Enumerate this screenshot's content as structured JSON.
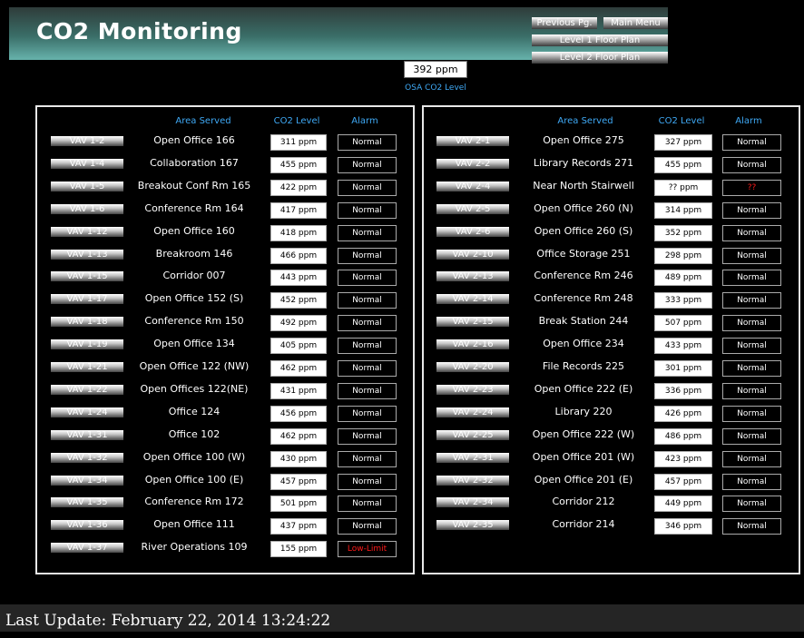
{
  "header": {
    "title": "CO2 Monitoring",
    "previous_label": "Previous Pg.",
    "main_menu_label": "Main Menu",
    "level1_label": "Level 1 Floor Plan",
    "level2_label": "Level 2 Floor Plan"
  },
  "osa": {
    "value": "392 ppm",
    "label": "OSA CO2 Level"
  },
  "columns": {
    "area": "Area Served",
    "co2": "CO2 Level",
    "alarm": "Alarm"
  },
  "left": [
    {
      "vav": "VAV 1-2",
      "area": "Open Office 166",
      "co2": "311 ppm",
      "alarm": "Normal"
    },
    {
      "vav": "VAV 1-4",
      "area": "Collaboration 167",
      "co2": "455 ppm",
      "alarm": "Normal"
    },
    {
      "vav": "VAV 1-5",
      "area": "Breakout Conf Rm 165",
      "co2": "422 ppm",
      "alarm": "Normal"
    },
    {
      "vav": "VAV 1-6",
      "area": "Conference Rm 164",
      "co2": "417 ppm",
      "alarm": "Normal"
    },
    {
      "vav": "VAV 1-12",
      "area": "Open Office 160",
      "co2": "418 ppm",
      "alarm": "Normal"
    },
    {
      "vav": "VAV 1-13",
      "area": "Breakroom 146",
      "co2": "466 ppm",
      "alarm": "Normal"
    },
    {
      "vav": "VAV 1-15",
      "area": "Corridor 007",
      "co2": "443 ppm",
      "alarm": "Normal"
    },
    {
      "vav": "VAV 1-17",
      "area": "Open Office 152 (S)",
      "co2": "452 ppm",
      "alarm": "Normal"
    },
    {
      "vav": "VAV 1-18",
      "area": "Conference Rm 150",
      "co2": "492 ppm",
      "alarm": "Normal"
    },
    {
      "vav": "VAV 1-19",
      "area": "Open Office 134",
      "co2": "405 ppm",
      "alarm": "Normal"
    },
    {
      "vav": "VAV 1-21",
      "area": "Open Office 122 (NW)",
      "co2": "462 ppm",
      "alarm": "Normal"
    },
    {
      "vav": "VAV 1-22",
      "area": "Open Offices 122(NE)",
      "co2": "431 ppm",
      "alarm": "Normal"
    },
    {
      "vav": "VAV 1-24",
      "area": "Office 124",
      "co2": "456 ppm",
      "alarm": "Normal"
    },
    {
      "vav": "VAV 1-31",
      "area": "Office 102",
      "co2": "462 ppm",
      "alarm": "Normal"
    },
    {
      "vav": "VAV 1-32",
      "area": "Open Office 100 (W)",
      "co2": "430 ppm",
      "alarm": "Normal"
    },
    {
      "vav": "VAV 1-34",
      "area": "Open Office 100 (E)",
      "co2": "457 ppm",
      "alarm": "Normal"
    },
    {
      "vav": "VAV 1-35",
      "area": "Conference Rm 172",
      "co2": "501 ppm",
      "alarm": "Normal"
    },
    {
      "vav": "VAV 1-36",
      "area": "Open Office 111",
      "co2": "437 ppm",
      "alarm": "Normal"
    },
    {
      "vav": "VAV 1-37",
      "area": "River Operations 109",
      "co2": "155 ppm",
      "alarm": "Low-Limit",
      "alarm_color": "#ff1a1a"
    }
  ],
  "right": [
    {
      "vav": "VAV 2-1",
      "area": "Open Office 275",
      "co2": "327 ppm",
      "alarm": "Normal"
    },
    {
      "vav": "VAV 2-2",
      "area": "Library Records 271",
      "co2": "455 ppm",
      "alarm": "Normal"
    },
    {
      "vav": "VAV 2-4",
      "area": "Near North Stairwell",
      "co2": "?? ppm",
      "alarm": "??",
      "alarm_color": "#ff1a1a"
    },
    {
      "vav": "VAV 2-5",
      "area": "Open Office 260 (N)",
      "co2": "314 ppm",
      "alarm": "Normal"
    },
    {
      "vav": "VAV 2-6",
      "area": "Open Office 260 (S)",
      "co2": "352 ppm",
      "alarm": "Normal"
    },
    {
      "vav": "VAV 2-10",
      "area": "Office Storage 251",
      "co2": "298 ppm",
      "alarm": "Normal"
    },
    {
      "vav": "VAV 2-13",
      "area": "Conference Rm 246",
      "co2": "489 ppm",
      "alarm": "Normal"
    },
    {
      "vav": "VAV 2-14",
      "area": "Conference Rm 248",
      "co2": "333 ppm",
      "alarm": "Normal"
    },
    {
      "vav": "VAV 2-15",
      "area": "Break Station 244",
      "co2": "507 ppm",
      "alarm": "Normal"
    },
    {
      "vav": "VAV 2-16",
      "area": "Open Office 234",
      "co2": "433 ppm",
      "alarm": "Normal"
    },
    {
      "vav": "VAV 2-20",
      "area": "File Records 225",
      "co2": "301 ppm",
      "alarm": "Normal"
    },
    {
      "vav": "VAV 2-23",
      "area": "Open Office 222 (E)",
      "co2": "336 ppm",
      "alarm": "Normal"
    },
    {
      "vav": "VAV 2-24",
      "area": "Library 220",
      "co2": "426 ppm",
      "alarm": "Normal"
    },
    {
      "vav": "VAV 2-25",
      "area": "Open Office 222 (W)",
      "co2": "486 ppm",
      "alarm": "Normal"
    },
    {
      "vav": "VAV 2-31",
      "area": "Open Office 201 (W)",
      "co2": "423 ppm",
      "alarm": "Normal"
    },
    {
      "vav": "VAV 2-32",
      "area": "Open Office 201 (E)",
      "co2": "457 ppm",
      "alarm": "Normal"
    },
    {
      "vav": "VAV 2-34",
      "area": "Corridor 212",
      "co2": "449 ppm",
      "alarm": "Normal"
    },
    {
      "vav": "VAV 2-35",
      "area": "Corridor 214",
      "co2": "346 ppm",
      "alarm": "Normal"
    }
  ],
  "footer": {
    "last_update": "Last Update: February 22, 2014 13:24:22"
  }
}
